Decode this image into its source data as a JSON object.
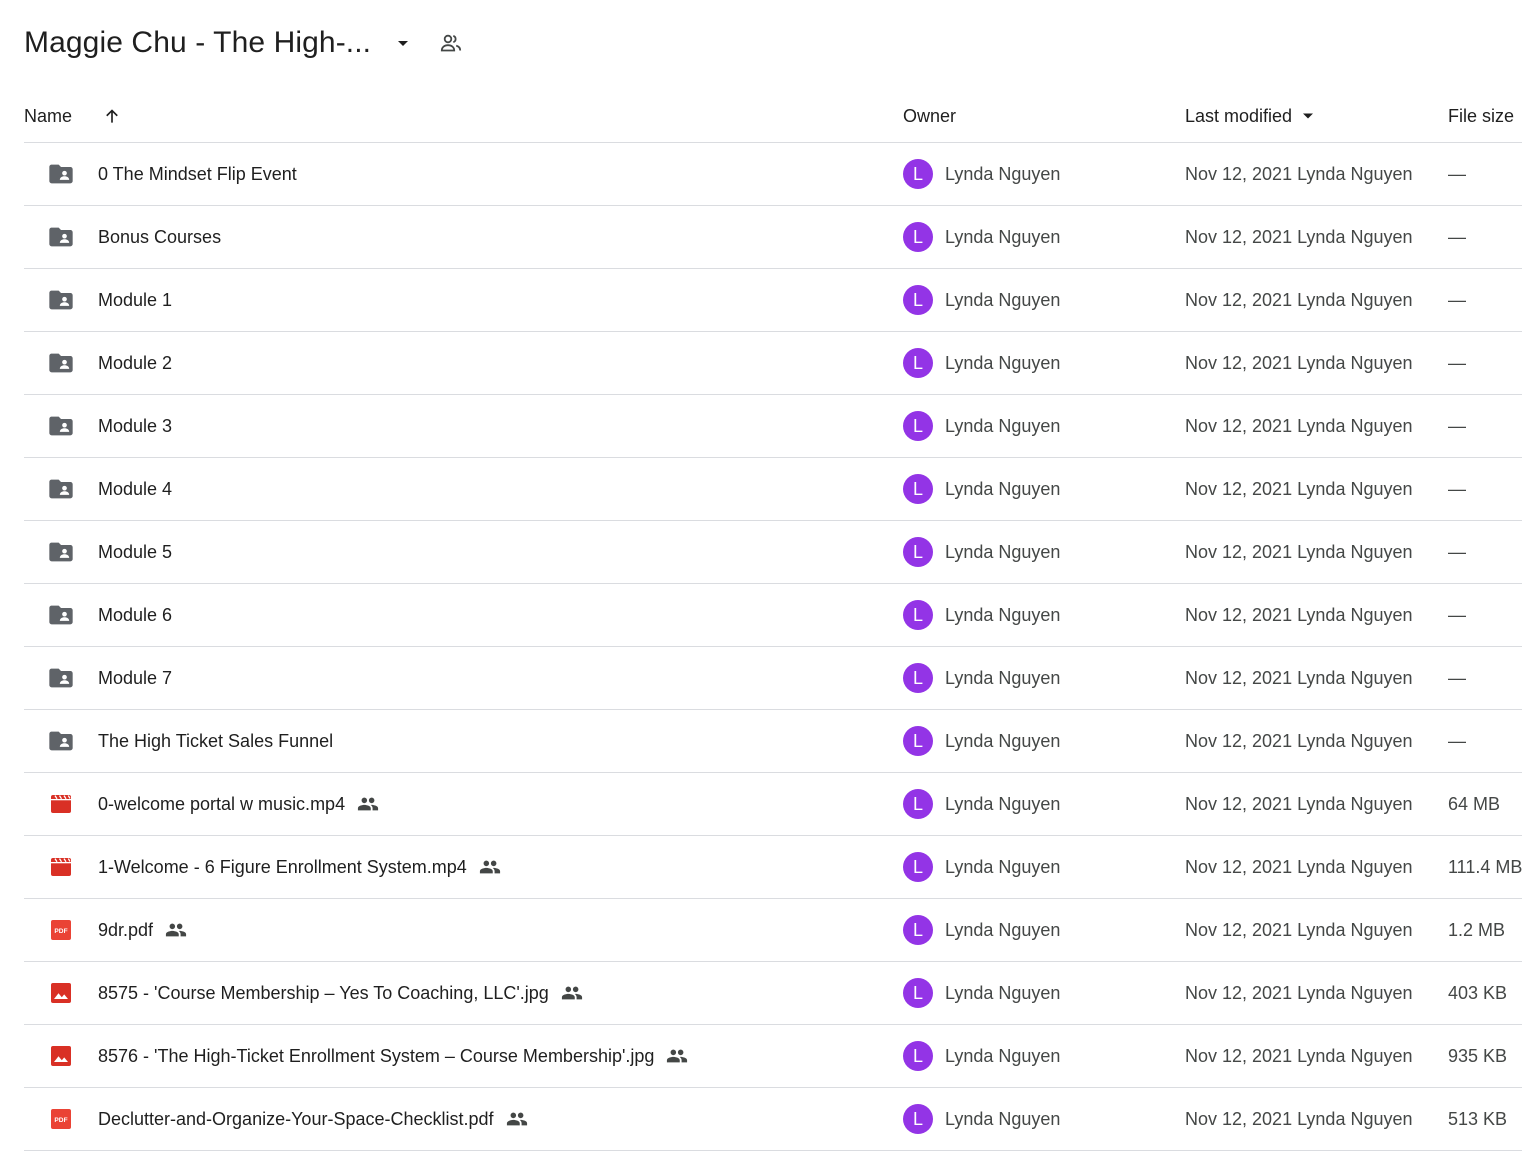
{
  "header": {
    "title": "Maggie Chu - The High-...",
    "dropdown_icon": "arrow-drop-down-icon",
    "shared_icon": "people-icon"
  },
  "columns": {
    "name": "Name",
    "owner": "Owner",
    "last_modified": "Last modified",
    "file_size": "File size"
  },
  "colors": {
    "folder": "#5f6368",
    "video": "#d93025",
    "pdf": "#ea4335",
    "image": "#d93025",
    "avatar": "#9334e6"
  },
  "rows": [
    {
      "name": "0 The Mindset Flip Event",
      "icon": "shared-folder-icon",
      "shared": false,
      "avatar": "L",
      "owner": "Lynda Nguyen",
      "modified": "Nov 12, 2021 Lynda Nguyen",
      "size": "—"
    },
    {
      "name": "Bonus Courses",
      "icon": "shared-folder-icon",
      "shared": false,
      "avatar": "L",
      "owner": "Lynda Nguyen",
      "modified": "Nov 12, 2021 Lynda Nguyen",
      "size": "—"
    },
    {
      "name": "Module 1",
      "icon": "shared-folder-icon",
      "shared": false,
      "avatar": "L",
      "owner": "Lynda Nguyen",
      "modified": "Nov 12, 2021 Lynda Nguyen",
      "size": "—"
    },
    {
      "name": "Module 2",
      "icon": "shared-folder-icon",
      "shared": false,
      "avatar": "L",
      "owner": "Lynda Nguyen",
      "modified": "Nov 12, 2021 Lynda Nguyen",
      "size": "—"
    },
    {
      "name": "Module 3",
      "icon": "shared-folder-icon",
      "shared": false,
      "avatar": "L",
      "owner": "Lynda Nguyen",
      "modified": "Nov 12, 2021 Lynda Nguyen",
      "size": "—"
    },
    {
      "name": "Module 4",
      "icon": "shared-folder-icon",
      "shared": false,
      "avatar": "L",
      "owner": "Lynda Nguyen",
      "modified": "Nov 12, 2021 Lynda Nguyen",
      "size": "—"
    },
    {
      "name": "Module 5",
      "icon": "shared-folder-icon",
      "shared": false,
      "avatar": "L",
      "owner": "Lynda Nguyen",
      "modified": "Nov 12, 2021 Lynda Nguyen",
      "size": "—"
    },
    {
      "name": "Module 6",
      "icon": "shared-folder-icon",
      "shared": false,
      "avatar": "L",
      "owner": "Lynda Nguyen",
      "modified": "Nov 12, 2021 Lynda Nguyen",
      "size": "—"
    },
    {
      "name": "Module 7",
      "icon": "shared-folder-icon",
      "shared": false,
      "avatar": "L",
      "owner": "Lynda Nguyen",
      "modified": "Nov 12, 2021 Lynda Nguyen",
      "size": "—"
    },
    {
      "name": "The High Ticket Sales Funnel",
      "icon": "shared-folder-icon",
      "shared": false,
      "avatar": "L",
      "owner": "Lynda Nguyen",
      "modified": "Nov 12, 2021 Lynda Nguyen",
      "size": "—"
    },
    {
      "name": "0-welcome portal w music.mp4",
      "icon": "video-file-icon",
      "shared": true,
      "avatar": "L",
      "owner": "Lynda Nguyen",
      "modified": "Nov 12, 2021 Lynda Nguyen",
      "size": "64 MB"
    },
    {
      "name": "1-Welcome - 6 Figure Enrollment System.mp4",
      "icon": "video-file-icon",
      "shared": true,
      "avatar": "L",
      "owner": "Lynda Nguyen",
      "modified": "Nov 12, 2021 Lynda Nguyen",
      "size": "111.4 MB"
    },
    {
      "name": "9dr.pdf",
      "icon": "pdf-file-icon",
      "pdf_badge": "PDF",
      "shared": true,
      "avatar": "L",
      "owner": "Lynda Nguyen",
      "modified": "Nov 12, 2021 Lynda Nguyen",
      "size": "1.2 MB"
    },
    {
      "name": "8575 - 'Course Membership – Yes To Coaching, LLC'.jpg",
      "icon": "image-file-icon",
      "shared": true,
      "avatar": "L",
      "owner": "Lynda Nguyen",
      "modified": "Nov 12, 2021 Lynda Nguyen",
      "size": "403 KB"
    },
    {
      "name": "8576 - 'The High-Ticket Enrollment System – Course Membership'.jpg",
      "icon": "image-file-icon",
      "shared": true,
      "avatar": "L",
      "owner": "Lynda Nguyen",
      "modified": "Nov 12, 2021 Lynda Nguyen",
      "size": "935 KB"
    },
    {
      "name": "Declutter-and-Organize-Your-Space-Checklist.pdf",
      "icon": "pdf-file-icon",
      "pdf_badge": "PDF",
      "shared": true,
      "avatar": "L",
      "owner": "Lynda Nguyen",
      "modified": "Nov 12, 2021 Lynda Nguyen",
      "size": "513 KB"
    }
  ]
}
